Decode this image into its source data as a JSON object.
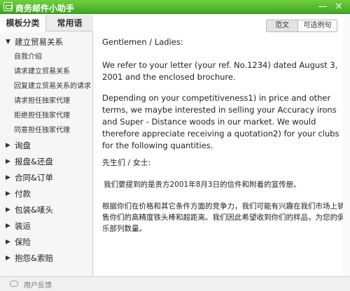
{
  "window": {
    "title": "商务邮件小助手",
    "minimize_glyph": "—",
    "close_glyph": "×"
  },
  "sidebar": {
    "tabs": [
      {
        "label": "模板分类",
        "active": true
      },
      {
        "label": "常用语",
        "active": false
      }
    ],
    "open_category": {
      "label": "建立贸易关系",
      "arrow": "▼",
      "items": [
        "自我介绍",
        "请求建立贸易关系",
        "回复建立贸易关系的请求",
        "请求担任独家代理",
        "拒绝担任独家代理",
        "同意担任独家代理"
      ]
    },
    "categories": [
      {
        "label": "询盘",
        "arrow": "▶"
      },
      {
        "label": "报盘&还盘",
        "arrow": "▶"
      },
      {
        "label": "合同&订单",
        "arrow": "▶"
      },
      {
        "label": "付款",
        "arrow": "▶"
      },
      {
        "label": "包装&唛头",
        "arrow": "▶"
      },
      {
        "label": "装运",
        "arrow": "▶"
      },
      {
        "label": "保险",
        "arrow": "▶"
      },
      {
        "label": "抱怨&索赔",
        "arrow": "▶"
      }
    ]
  },
  "toolbar": {
    "sample_label": "范文",
    "sentences_label": "可选例句"
  },
  "content": {
    "greeting_en": "Gentlemen / Ladies:",
    "para1_en": "We refer to your letter (your ref. No.1234) dated August 3, 2001 and the enclosed brochure.",
    "para2_en": "Depending on your competitiveness1) in price and other terms, we maybe interested in selling your Accuracy irons and Super - Distance woods in our market. We would therefore appreciate receiving a quotation2) for your clubs for the following quantities.",
    "greeting_zh": "先生们 / 女士:",
    "para1_zh": " 我们要提到的是贵方2001年8月3日的信件和附着的宣传册。",
    "para2_zh": "根据你们在价格和其它条件方面的竞争力，我们可能有兴趣在我们市场上销售你们的高精度铁头棒和超距离。我们因此希望收到你们的样品，为您的俱乐部列数量。"
  },
  "statusbar": {
    "feedback_label": "用户反馈"
  }
}
